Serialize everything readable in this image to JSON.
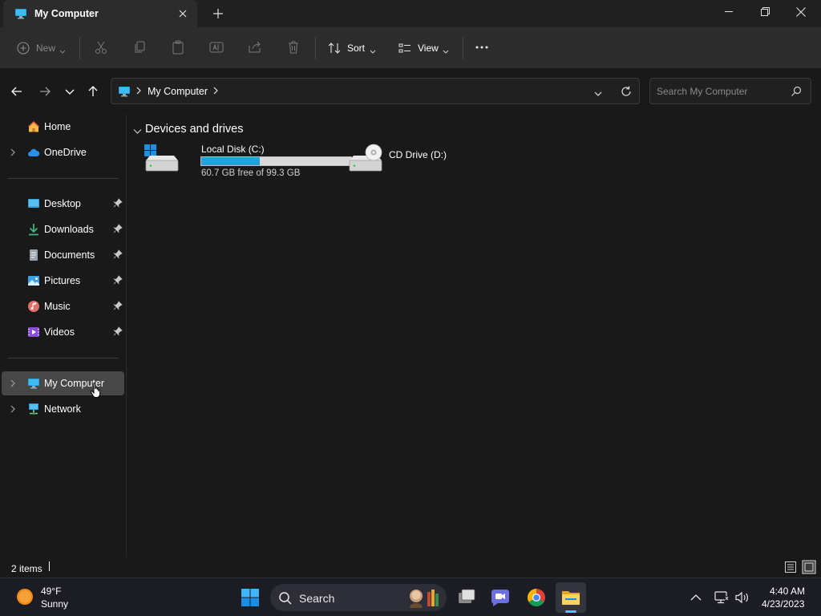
{
  "window": {
    "tab_title": "My Computer",
    "accent": "#26a0da",
    "icons": {
      "tab": "monitor-icon",
      "close_tab": "close-icon",
      "new_tab": "plus-icon",
      "minimize": "minimize-icon",
      "maximize": "restore-icon",
      "close": "close-icon"
    }
  },
  "toolbar": {
    "new_label": "New",
    "sort_label": "Sort",
    "view_label": "View",
    "icons": [
      "plus-circle-icon",
      "cut-icon",
      "copy-icon",
      "paste-icon",
      "rename-icon",
      "share-icon",
      "delete-icon",
      "sort-icon",
      "view-icon",
      "more-icon"
    ]
  },
  "address": {
    "crumb": "My Computer",
    "search_placeholder": "Search My Computer"
  },
  "sidebar": {
    "home": "Home",
    "onedrive": "OneDrive",
    "pinned": [
      {
        "label": "Desktop",
        "icon": "desktop-icon"
      },
      {
        "label": "Downloads",
        "icon": "download-icon"
      },
      {
        "label": "Documents",
        "icon": "document-icon"
      },
      {
        "label": "Pictures",
        "icon": "pictures-icon"
      },
      {
        "label": "Music",
        "icon": "music-icon"
      },
      {
        "label": "Videos",
        "icon": "video-icon"
      }
    ],
    "my_computer": "My Computer",
    "network": "Network"
  },
  "content": {
    "group_header": "Devices and drives",
    "drives": [
      {
        "name": "Local Disk (C:)",
        "free_text": "60.7 GB free of 99.3 GB",
        "used_fraction": 0.389
      },
      {
        "name": "CD Drive (D:)"
      }
    ]
  },
  "status": {
    "items": "2 items"
  },
  "taskbar": {
    "weather_temp": "49°F",
    "weather_cond": "Sunny",
    "search_label": "Search",
    "time": "4:40 AM",
    "date": "4/23/2023",
    "apps": [
      "windows-start-icon",
      "task-view-icon",
      "teams-chat-icon",
      "chrome-icon",
      "file-explorer-icon"
    ]
  }
}
